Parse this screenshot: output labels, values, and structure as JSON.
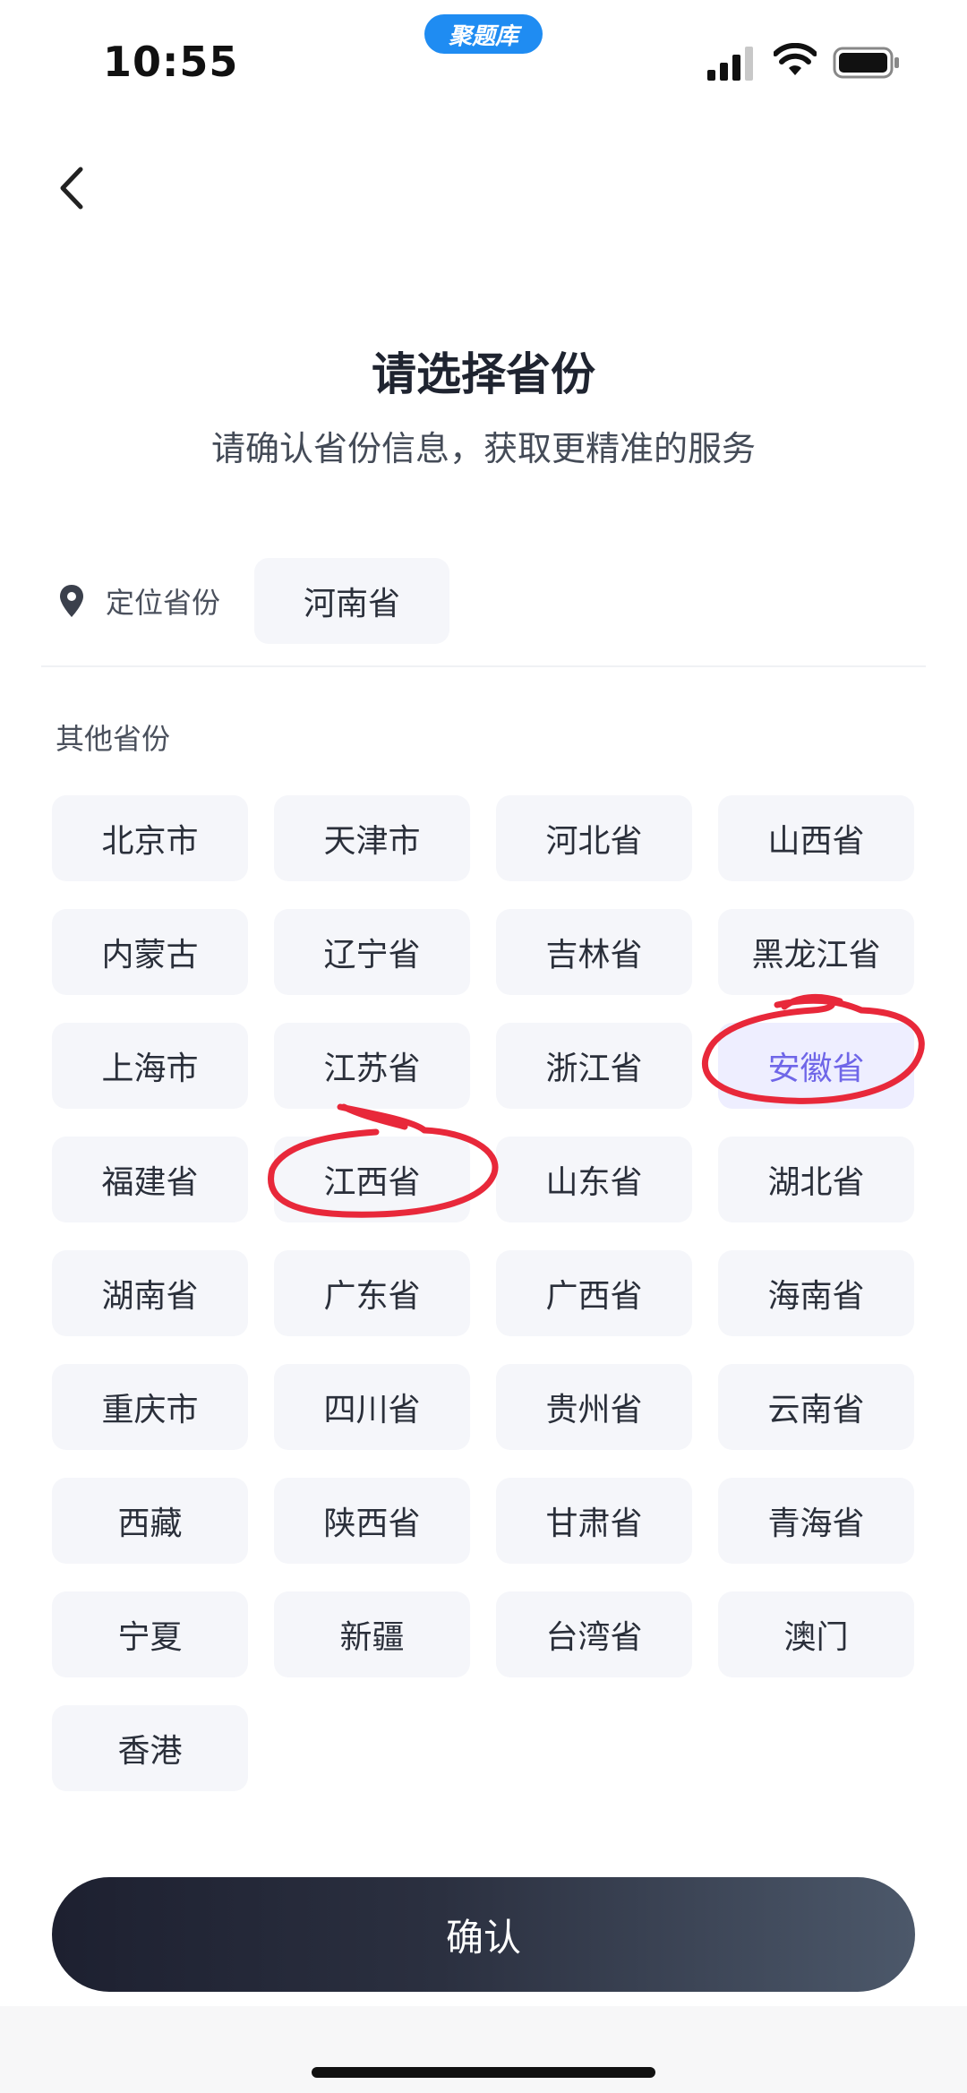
{
  "status_bar": {
    "time": "10:55",
    "app_badge": "聚题库",
    "icons": [
      "signal-icon",
      "wifi-icon",
      "battery-icon"
    ]
  },
  "header": {
    "back_icon": "chevron-left-icon",
    "title": "请选择省份",
    "subtitle": "请确认省份信息，获取更精准的服务"
  },
  "location": {
    "icon": "location-pin-icon",
    "label": "定位省份",
    "value": "河南省"
  },
  "others": {
    "label": "其他省份",
    "provinces": [
      {
        "name": "北京市"
      },
      {
        "name": "天津市"
      },
      {
        "name": "河北省"
      },
      {
        "name": "山西省"
      },
      {
        "name": "内蒙古"
      },
      {
        "name": "辽宁省"
      },
      {
        "name": "吉林省"
      },
      {
        "name": "黑龙江省"
      },
      {
        "name": "上海市"
      },
      {
        "name": "江苏省"
      },
      {
        "name": "浙江省"
      },
      {
        "name": "安徽省"
      },
      {
        "name": "福建省"
      },
      {
        "name": "江西省"
      },
      {
        "name": "山东省"
      },
      {
        "name": "湖北省"
      },
      {
        "name": "湖南省"
      },
      {
        "name": "广东省"
      },
      {
        "name": "广西省"
      },
      {
        "name": "海南省"
      },
      {
        "name": "重庆市"
      },
      {
        "name": "四川省"
      },
      {
        "name": "贵州省"
      },
      {
        "name": "云南省"
      },
      {
        "name": "西藏"
      },
      {
        "name": "陕西省"
      },
      {
        "name": "甘肃省"
      },
      {
        "name": "青海省"
      },
      {
        "name": "宁夏"
      },
      {
        "name": "新疆"
      },
      {
        "name": "台湾省"
      },
      {
        "name": "澳门"
      },
      {
        "name": "香港"
      }
    ],
    "selected": "安徽省",
    "circled": [
      "安徽省",
      "江西省"
    ]
  },
  "confirm_label": "确认",
  "colors": {
    "selected_text": "#6f66e8",
    "selected_bg": "#eeeeff",
    "annotation_red": "#e8283a",
    "badge_blue": "#1f8cf2"
  }
}
